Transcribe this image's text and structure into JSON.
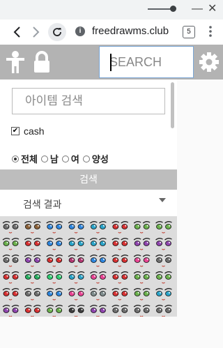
{
  "browser": {
    "url": "freedrawms.club",
    "tab_count": "5",
    "icons": [
      "back-arrow-icon",
      "forward-arrow-icon",
      "reload-icon",
      "info-icon",
      "menu-dots-icon",
      "minimize-icon",
      "close-icon"
    ]
  },
  "header": {
    "search_placeholder": "SEARCH",
    "bg_color": "#b3b3b3",
    "icons": [
      "character-icon",
      "lock-icon",
      "gear-icon"
    ]
  },
  "filter": {
    "item_search_placeholder": "아이템 검색",
    "cash_label": "cash",
    "cash_checked": true,
    "gender_options": [
      "전체",
      "남",
      "여",
      "양성"
    ],
    "gender_selected": "전체",
    "search_button_label": "검색",
    "result_label": "검색 결과"
  },
  "results": {
    "rows": 6,
    "cols": 8,
    "eye_colors": [
      [
        "#6e6e6e",
        "#8c6239",
        "#2e86de",
        "#2e86de",
        "#2aa3c8",
        "#d63031",
        "#6ab04c",
        "#6ab04c"
      ],
      [
        "#6ab04c",
        "#d63031",
        "#2e86de",
        "#2aa3c8",
        "#2aa3c8",
        "#d63031",
        "#8e44ad",
        "#8e44ad"
      ],
      [
        "#6e6e6e",
        "#8e44ad",
        "#d63031",
        "#b33771",
        "#2e86de",
        "#d63031",
        "#e84393",
        "#6e6e6e"
      ],
      [
        "#d63031",
        "#27ae60",
        "#2ecc71",
        "#2aa3c8",
        "#e84393",
        "#d63031",
        "#6ab04c",
        "#6ab04c"
      ],
      [
        "#d63031",
        "#6e6e6e",
        "#2e86de",
        "#e84393",
        "#7f8c8d",
        "#d63031",
        "#6ab04c",
        "#2aa3c8"
      ],
      [
        "#8e44ad",
        "#d63031",
        "#6ab04c",
        "#3d3d3d",
        "#8e44ad",
        "#6e6e6e",
        "#6e6e6e",
        "#6e6e6e"
      ]
    ]
  }
}
